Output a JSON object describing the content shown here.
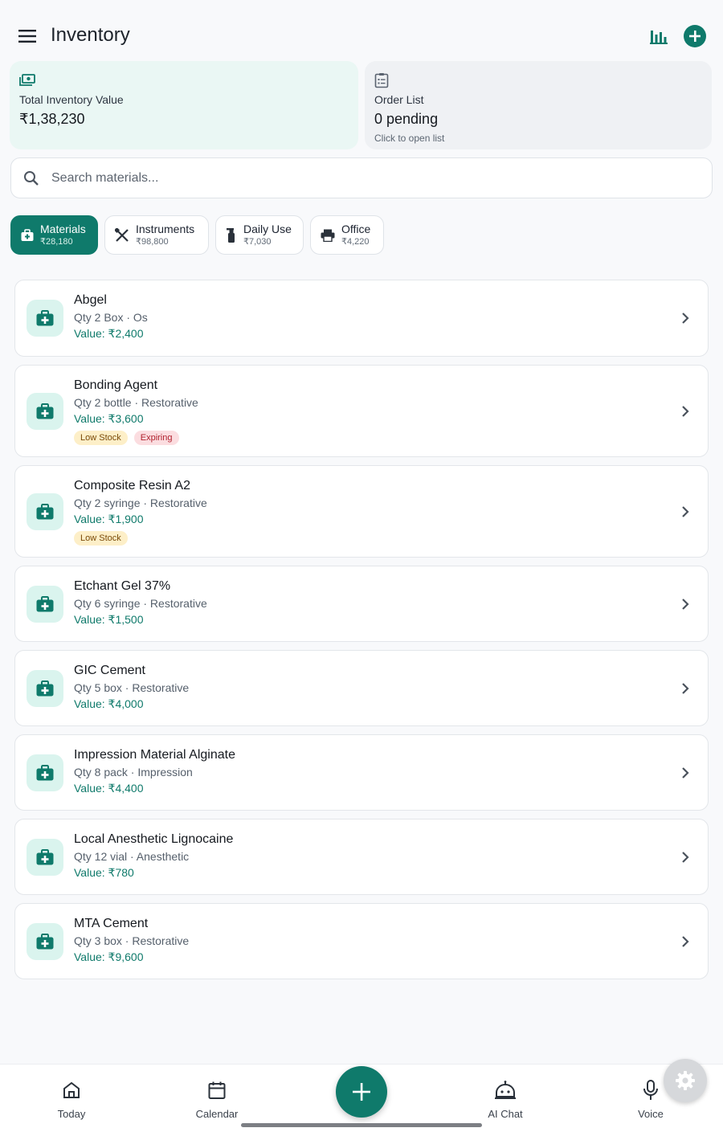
{
  "header": {
    "title": "Inventory"
  },
  "summary": {
    "inventory_label": "Total Inventory Value",
    "inventory_amount": "₹1,38,230",
    "order_label": "Order List",
    "order_status": "0 pending",
    "order_hint": "Click to open list"
  },
  "search": {
    "placeholder": "Search materials..."
  },
  "categories": [
    {
      "label": "Materials",
      "amount": "₹28,180",
      "active": true
    },
    {
      "label": "Instruments",
      "amount": "₹98,800",
      "active": false
    },
    {
      "label": "Daily Use",
      "amount": "₹7,030",
      "active": false
    },
    {
      "label": "Office",
      "amount": "₹4,220",
      "active": false
    }
  ],
  "items": [
    {
      "name": "Abgel",
      "meta": "Qty 2 Box · Os",
      "value": "Value: ₹2,400",
      "badges": []
    },
    {
      "name": "Bonding Agent",
      "meta": "Qty 2 bottle · Restorative",
      "value": "Value: ₹3,600",
      "badges": [
        "Low Stock",
        "Expiring"
      ]
    },
    {
      "name": "Composite Resin A2",
      "meta": "Qty 2 syringe · Restorative",
      "value": "Value: ₹1,900",
      "badges": [
        "Low Stock"
      ]
    },
    {
      "name": "Etchant Gel 37%",
      "meta": "Qty 6 syringe · Restorative",
      "value": "Value: ₹1,500",
      "badges": []
    },
    {
      "name": "GIC Cement",
      "meta": "Qty 5 box · Restorative",
      "value": "Value: ₹4,000",
      "badges": []
    },
    {
      "name": "Impression Material Alginate",
      "meta": "Qty 8 pack · Impression",
      "value": "Value: ₹4,400",
      "badges": []
    },
    {
      "name": "Local Anesthetic Lignocaine",
      "meta": "Qty 12 vial · Anesthetic",
      "value": "Value: ₹780",
      "badges": []
    },
    {
      "name": "MTA Cement",
      "meta": "Qty 3 box · Restorative",
      "value": "Value: ₹9,600",
      "badges": []
    }
  ],
  "nav": {
    "today": "Today",
    "calendar": "Calendar",
    "ai_chat": "AI Chat",
    "voice": "Voice"
  },
  "colors": {
    "accent": "#0f7a6b",
    "icon_bg": "#daf4ee",
    "low_stock": "#fdefc8",
    "expiring": "#fbdde0"
  },
  "icons": {
    "menu": "hamburger-icon",
    "chart": "bar-chart-icon",
    "add": "plus-circle-icon",
    "item": "medical-kit-icon",
    "settings": "gear-icon"
  }
}
